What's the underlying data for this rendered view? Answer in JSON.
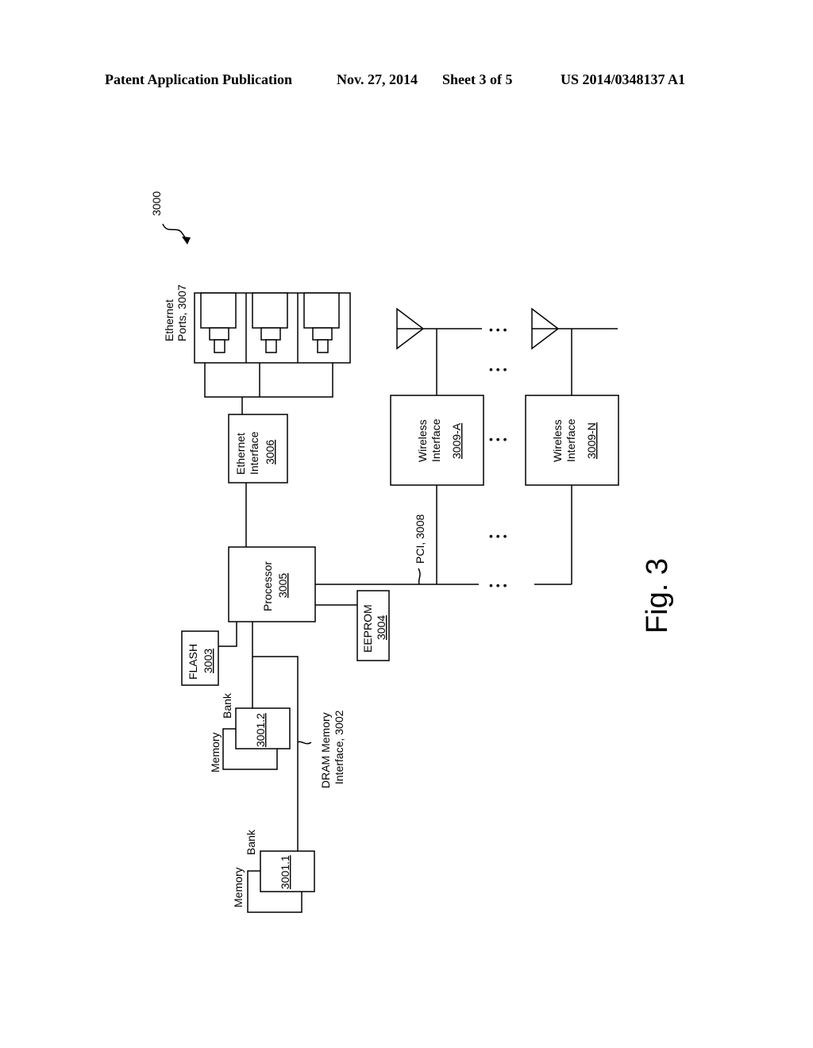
{
  "header": {
    "left": "Patent Application Publication",
    "date": "Nov. 27, 2014",
    "sheet": "Sheet 3 of 5",
    "pub_number": "US 2014/0348137 A1"
  },
  "figure": {
    "reference": "3000",
    "caption": "Fig. 3",
    "ethernet_ports": {
      "line1": "Ethernet",
      "line2": "Ports, 3007"
    },
    "ethernet_interface": {
      "line1": "Ethernet",
      "line2": "Interface",
      "ref": "3006"
    },
    "processor": {
      "line1": "Processor",
      "ref": "3005"
    },
    "eeprom": {
      "line1": "EEPROM",
      "ref": "3004"
    },
    "flash": {
      "line1": "FLASH",
      "ref": "3003"
    },
    "pci_label": "PCI, 3008",
    "dram_label": {
      "line1": "DRAM Memory",
      "line2": "Interface, 3002"
    },
    "memory_bank_2": {
      "line1": "Memory",
      "line2": "Bank",
      "ref": "3001.2"
    },
    "memory_bank_1": {
      "line1": "Memory",
      "line2": "Bank",
      "ref": "3001.1"
    },
    "wireless_a": {
      "line1": "Wireless",
      "line2": "Interface",
      "ref": "3009-A"
    },
    "wireless_n": {
      "line1": "Wireless",
      "line2": "Interface",
      "ref": "3009-N"
    },
    "ellipsis": "• • •"
  }
}
